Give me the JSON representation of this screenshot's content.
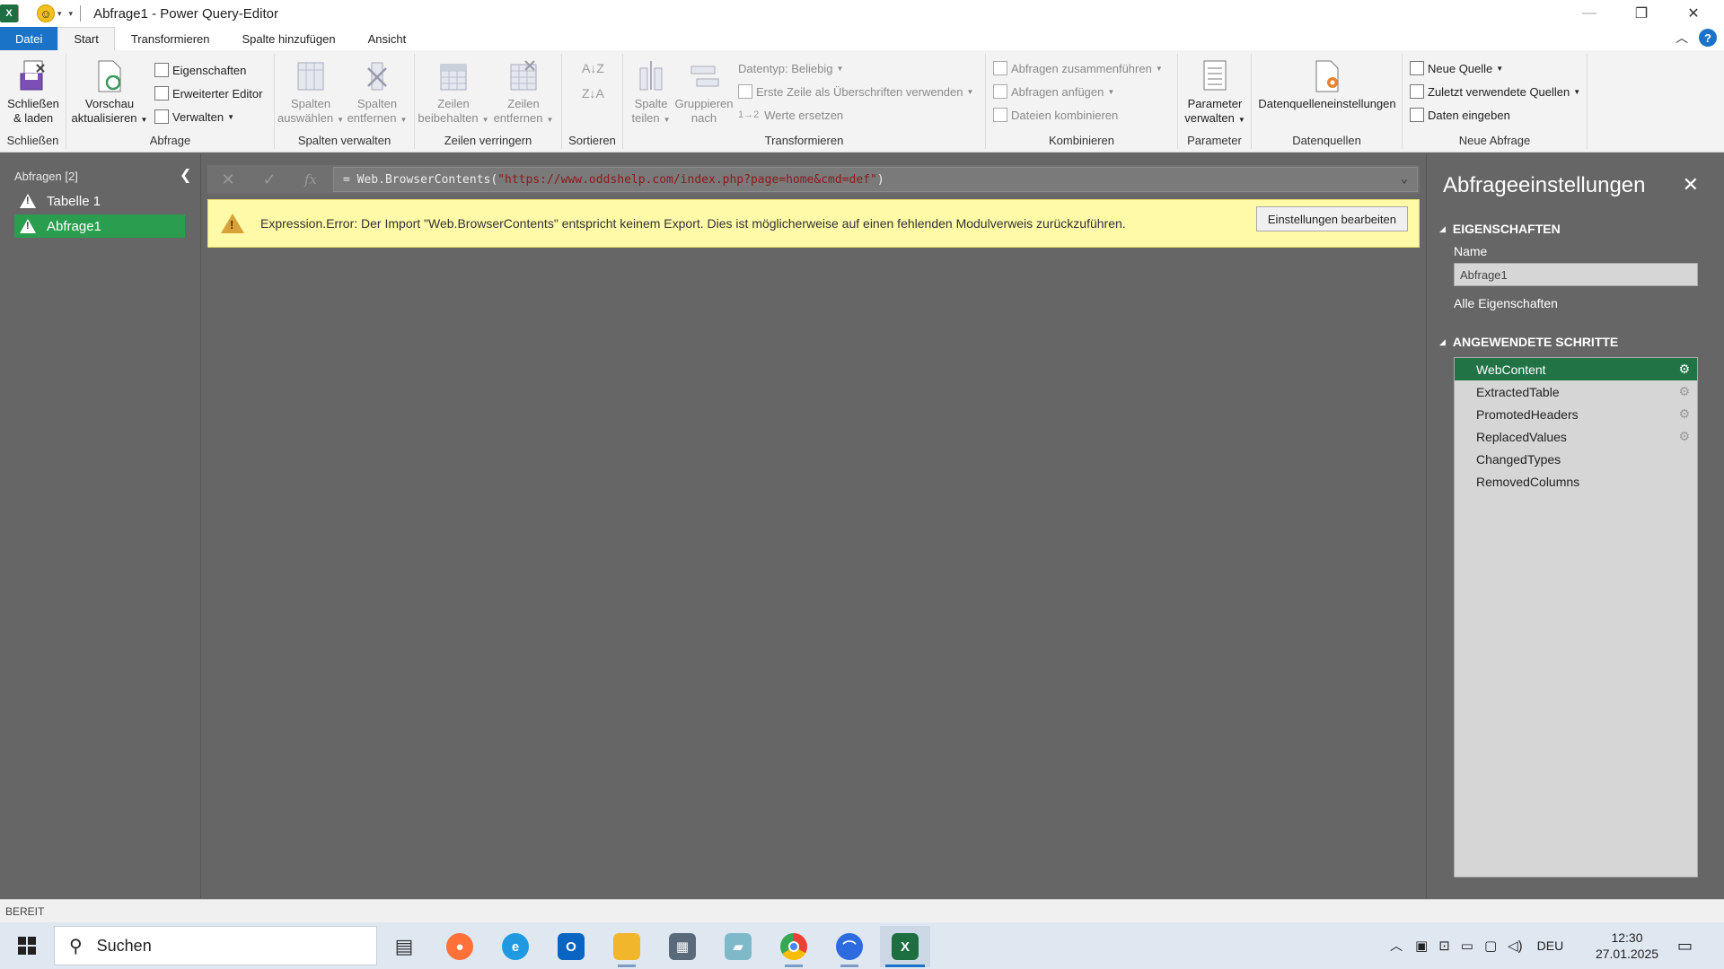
{
  "titlebar": {
    "app_logo": "X",
    "title": "Abfrage1 - Power Query-Editor",
    "minimize": "—",
    "restore": "❐",
    "close": "✕"
  },
  "tabs": [
    "Datei",
    "Start",
    "Transformieren",
    "Spalte hinzufügen",
    "Ansicht"
  ],
  "ribbon": {
    "close_load": {
      "label1": "Schließen",
      "label2": "& laden",
      "group": "Schließen"
    },
    "abfrage": {
      "refresh1": "Vorschau",
      "refresh2": "aktualisieren",
      "properties": "Eigenschaften",
      "adv_editor": "Erweiterter Editor",
      "manage": "Verwalten",
      "group": "Abfrage"
    },
    "spalten": {
      "choose1": "Spalten",
      "choose2": "auswählen",
      "remove1": "Spalten",
      "remove2": "entfernen",
      "group": "Spalten verwalten"
    },
    "zeilen": {
      "keep1": "Zeilen",
      "keep2": "beibehalten",
      "remove1": "Zeilen",
      "remove2": "entfernen",
      "group": "Zeilen verringern"
    },
    "sortieren": {
      "group": "Sortieren"
    },
    "transform": {
      "split1": "Spalte",
      "split2": "teilen",
      "group1": "Gruppieren",
      "group2": "nach",
      "datatype": "Datentyp: Beliebig",
      "firstrow": "Erste Zeile als Überschriften verwenden",
      "replace": "Werte ersetzen",
      "group": "Transformieren"
    },
    "kombinieren": {
      "merge": "Abfragen zusammenführen",
      "append": "Abfragen anfügen",
      "combine": "Dateien kombinieren",
      "group": "Kombinieren"
    },
    "parameter": {
      "label1": "Parameter",
      "label2": "verwalten",
      "group": "Parameter"
    },
    "datenquellen": {
      "label": "Datenquelleneinstellungen",
      "group": "Datenquellen"
    },
    "neue_abfrage": {
      "new_source": "Neue Quelle",
      "recent": "Zuletzt verwendete Quellen",
      "enter": "Daten eingeben",
      "group": "Neue Abfrage"
    }
  },
  "queries": {
    "header": "Abfragen [2]",
    "items": [
      {
        "label": "Tabelle 1",
        "selected": false
      },
      {
        "label": "Abfrage1",
        "selected": true
      }
    ]
  },
  "formula": {
    "prefix": "= Web.BrowserContents(",
    "url": "\"https://www.oddshelp.com/index.php?page=home&cmd=def\"",
    "suffix": ")"
  },
  "error": {
    "message": "Expression.Error: Der Import \"Web.BrowserContents\" entspricht keinem Export. Dies ist möglicherweise auf einen fehlenden Modulverweis zurückzuführen.",
    "button": "Einstellungen bearbeiten"
  },
  "settings": {
    "title": "Abfrageeinstellungen",
    "properties_header": "EIGENSCHAFTEN",
    "name_label": "Name",
    "name_value": "Abfrage1",
    "all_props": "Alle Eigenschaften",
    "steps_header": "ANGEWENDETE SCHRITTE",
    "steps": [
      {
        "label": "WebContent",
        "gear": true,
        "selected": true
      },
      {
        "label": "ExtractedTable",
        "gear": true,
        "selected": false
      },
      {
        "label": "PromotedHeaders",
        "gear": true,
        "selected": false
      },
      {
        "label": "ReplacedValues",
        "gear": true,
        "selected": false
      },
      {
        "label": "ChangedTypes",
        "gear": false,
        "selected": false
      },
      {
        "label": "RemovedColumns",
        "gear": false,
        "selected": false
      }
    ]
  },
  "statusbar": {
    "text": "BEREIT"
  },
  "taskbar": {
    "search": "Suchen",
    "lang": "DEU",
    "time": "12:30",
    "date": "27.01.2025"
  },
  "colors": {
    "accent_green": "#217346",
    "selected_query": "#2a9d4e",
    "file_tab": "#1a73c7",
    "error_bg": "#fffaa8"
  }
}
